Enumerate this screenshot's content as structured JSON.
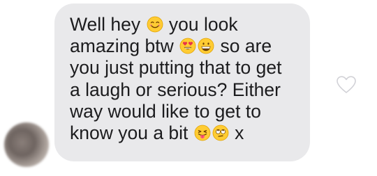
{
  "conversation": {
    "incoming_message": {
      "segments": {
        "s1": "Well hey ",
        "s2": " you look",
        "s3": "amazing btw ",
        "s4": " so are",
        "s5": "you just putting that to get",
        "s6": "a laugh or serious? Either",
        "s7": "way would like to get to",
        "s8": "know you a bit ",
        "s9": " x"
      },
      "emojis": [
        "smiling-face-emoji",
        "heart-eyes-emoji",
        "grinning-face-emoji",
        "tongue-out-emoji",
        "rolling-eyes-emoji"
      ],
      "bubble_color": "#e9e9eb",
      "text_color": "#1c1c1e"
    },
    "like_icon": "heart-outline-icon",
    "avatar": "sender-avatar"
  }
}
